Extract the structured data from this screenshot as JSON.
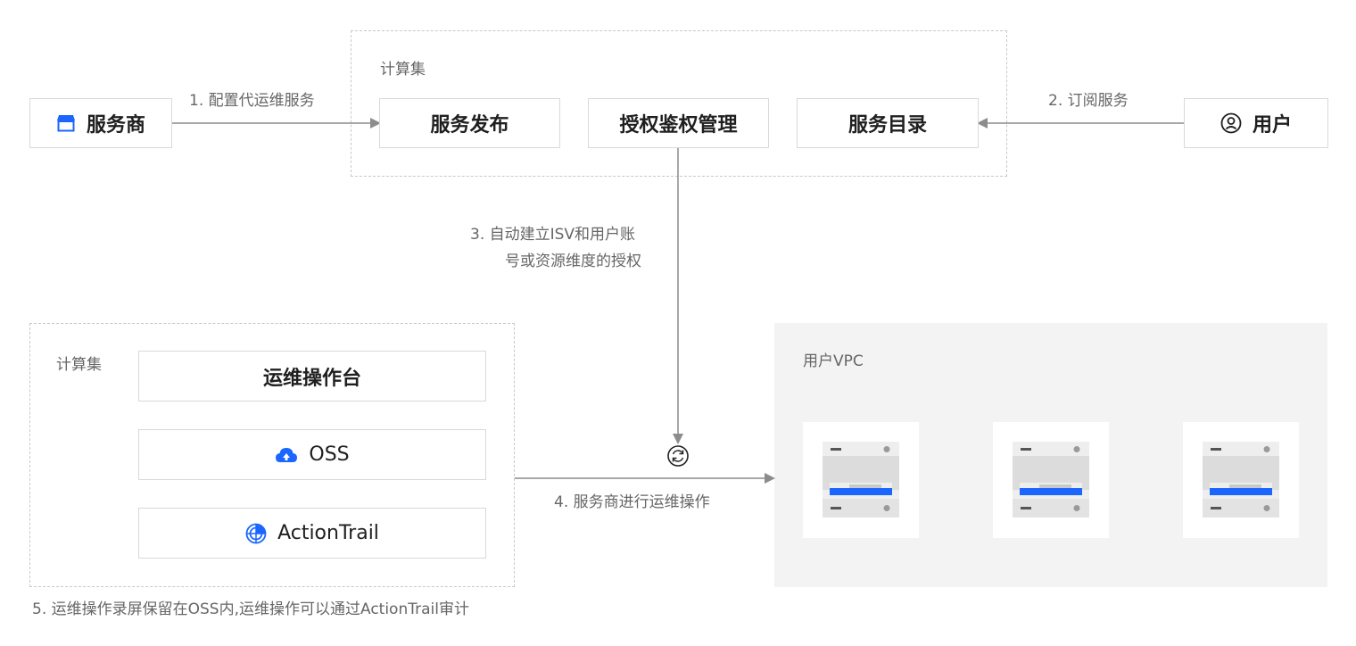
{
  "top_group": {
    "title": "计算集"
  },
  "bottom_group": {
    "title": "计算集"
  },
  "nodes": {
    "provider": "服务商",
    "publish": "服务发布",
    "auth": "授权鉴权管理",
    "catalog": "服务目录",
    "user": "用户",
    "ops_console": "运维操作台",
    "oss": "OSS",
    "action_trail": "ActionTrail"
  },
  "steps": {
    "step1": "1. 配置代运维服务",
    "step2": "2. 订阅服务",
    "step3_line1": "3. 自动建立ISV和用户账",
    "step3_line2": "号或资源维度的授权",
    "step4": "4. 服务商进行运维操作",
    "step5": "5. 运维操作录屏保留在OSS内,运维操作可以通过ActionTrail审计"
  },
  "vpc": {
    "title": "用户VPC",
    "server_count": 3
  },
  "icons": {
    "provider": "store-icon",
    "user": "user-circle-icon",
    "oss": "cloud-icon",
    "action_trail": "radar-icon",
    "sync": "refresh-cycle-icon",
    "server": "server-icon"
  },
  "colors": {
    "accent": "#1a66ff",
    "line": "#8c8c8c",
    "border": "#d9d9d9",
    "dashed": "#c8c8c8",
    "vpc_bg": "#f3f3f4"
  }
}
